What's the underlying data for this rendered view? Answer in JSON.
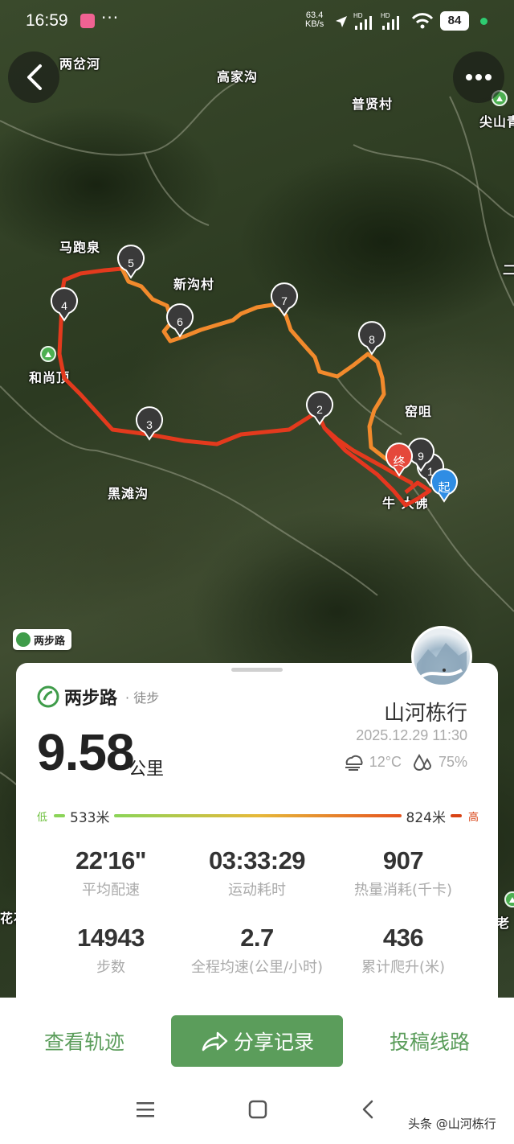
{
  "status_bar": {
    "time": "16:59",
    "net_speed_value": "63.4",
    "net_speed_unit": "KB/s",
    "battery": "84",
    "sim_label": "HD"
  },
  "map": {
    "labels": {
      "liangchahe": "两岔河",
      "gaojiagou": "高家沟",
      "puxiancun": "普贤村",
      "jianshan": "尖山青",
      "mapaoquan": "马跑泉",
      "xingoucun": "新沟村",
      "heshangding": "和尚顶",
      "yaozu": "窑咀",
      "heitangou": "黑滩沟",
      "niu_bigfo": "牛 大佛",
      "huapo": "花石",
      "laoer": "老",
      "edge_two": "二"
    },
    "waypoints": [
      "1",
      "2",
      "3",
      "4",
      "5",
      "6",
      "7",
      "8",
      "9"
    ],
    "start_label": "起",
    "end_label": "终",
    "logo_text": "两步路"
  },
  "card": {
    "brand": "两步路",
    "activity": "· 徒步",
    "user": "山河栋行",
    "datetime": "2025.12.29 11:30",
    "distance": "9.58",
    "distance_unit": "公里",
    "temperature": "12°C",
    "humidity": "75%",
    "elev_low_label": "低",
    "elev_low": "533米",
    "elev_high": "824米",
    "elev_high_label": "高",
    "stats": [
      {
        "value": "22'16\"",
        "label": "平均配速"
      },
      {
        "value": "03:33:29",
        "label": "运动耗时"
      },
      {
        "value": "907",
        "label": "热量消耗(千卡)"
      },
      {
        "value": "14943",
        "label": "步数"
      },
      {
        "value": "2.7",
        "label": "全程均速(公里/小时)"
      },
      {
        "value": "436",
        "label": "累计爬升(米)"
      }
    ]
  },
  "actions": {
    "view_track": "查看轨迹",
    "share": "分享记录",
    "submit_route": "投稿线路"
  },
  "watermark": "头条 @山河栋行",
  "colors": {
    "accent_green": "#5b9d5b",
    "track_red": "#e6361f",
    "track_orange": "#f0902a",
    "start_blue": "#2f8de4",
    "end_red": "#e5483b"
  }
}
